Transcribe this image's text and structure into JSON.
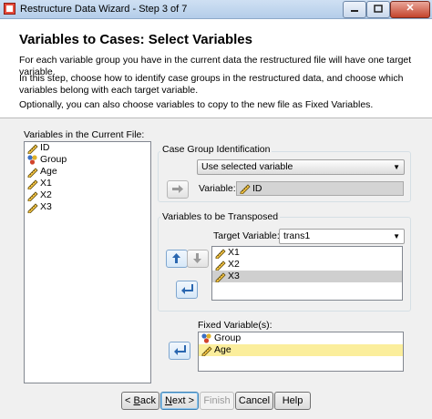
{
  "window": {
    "title": "Restructure Data Wizard - Step 3 of 7"
  },
  "header": {
    "title": "Variables to Cases: Select Variables",
    "desc1": "For each variable group you have in the current data the restructured file will have one target variable.",
    "desc2": "In this step, choose how to identify case groups in the restructured data, and choose which variables belong with each target variable.",
    "desc3": "Optionally, you can also choose variables to copy to the new file as Fixed Variables."
  },
  "source": {
    "label": "Variables in the Current File:",
    "items": [
      {
        "label": "ID",
        "icon": "scale-icon"
      },
      {
        "label": "Group",
        "icon": "nominal-icon"
      },
      {
        "label": "Age",
        "icon": "scale-icon"
      },
      {
        "label": "X1",
        "icon": "scale-icon"
      },
      {
        "label": "X2",
        "icon": "scale-icon"
      },
      {
        "label": "X3",
        "icon": "scale-icon"
      }
    ]
  },
  "case_group": {
    "title": "Case Group Identification",
    "selected": "Use selected variable",
    "variable_label": "Variable:",
    "variable_value": "ID"
  },
  "transposed": {
    "title": "Variables to be Transposed",
    "target_label": "Target Variable:",
    "target_value": "trans1",
    "items": [
      {
        "label": "X1",
        "icon": "scale-icon"
      },
      {
        "label": "X2",
        "icon": "scale-icon"
      },
      {
        "label": "X3",
        "icon": "scale-icon",
        "selected": true
      }
    ]
  },
  "fixed": {
    "label": "Fixed Variable(s):",
    "items": [
      {
        "label": "Group",
        "icon": "nominal-icon"
      },
      {
        "label": "Age",
        "icon": "scale-icon",
        "selected": true
      }
    ]
  },
  "buttons": {
    "back_prefix": "< ",
    "back_key": "B",
    "back_rest": "ack",
    "next_key": "N",
    "next_rest": "ext >",
    "finish": "Finish",
    "cancel": "Cancel",
    "help": "Help"
  },
  "window_controls": {
    "close": "✕"
  }
}
